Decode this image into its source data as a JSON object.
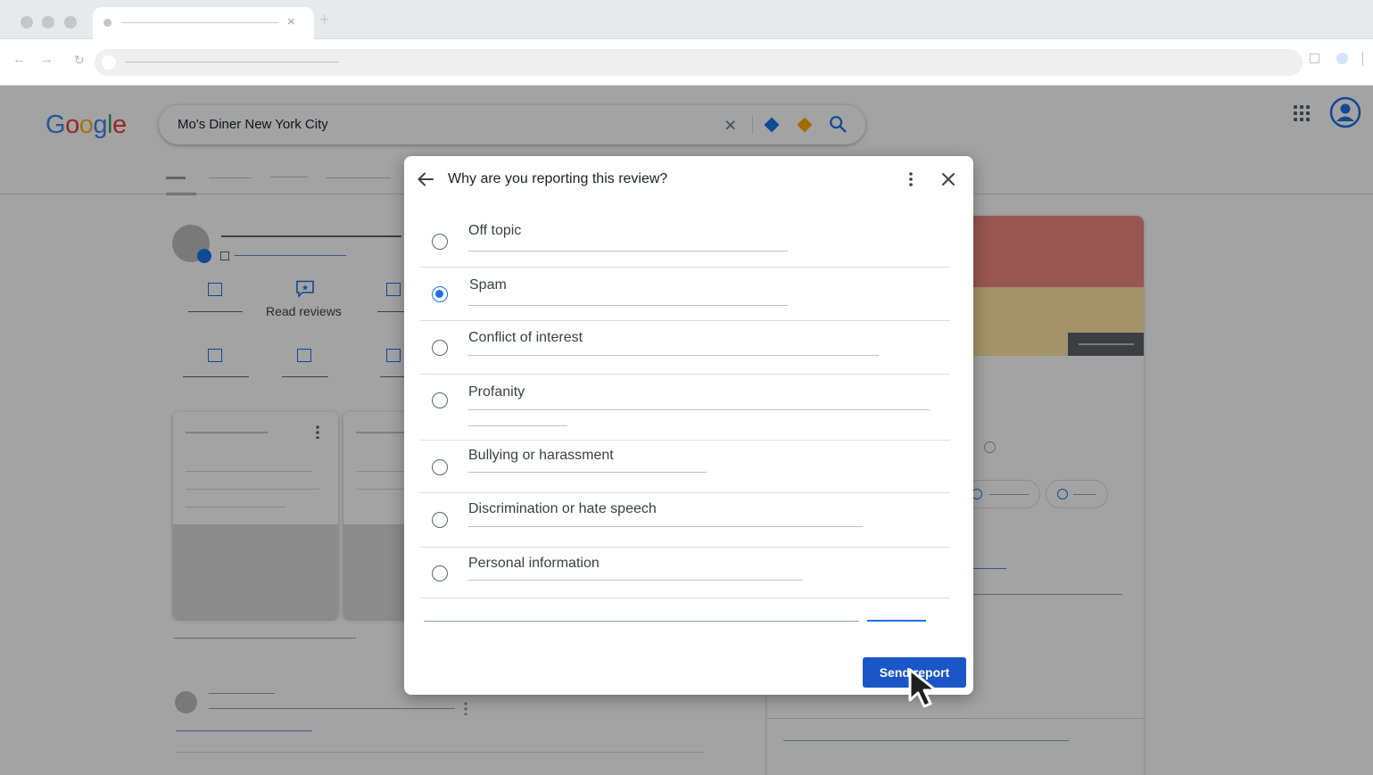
{
  "browser": {
    "tab_close_glyph": "×",
    "new_tab_glyph": "+",
    "back_glyph": "←",
    "forward_glyph": "→",
    "reload_glyph": "↻"
  },
  "search": {
    "logo": [
      "G",
      "o",
      "o",
      "g",
      "l",
      "e"
    ],
    "logo_colors": [
      "#4285f4",
      "#ea4335",
      "#fbbc05",
      "#4285f4",
      "#34a853",
      "#ea4335"
    ],
    "query": "Mo's Diner New York City",
    "clear_glyph": "×"
  },
  "business": {
    "read_reviews_label": "Read reviews"
  },
  "dialog": {
    "title": "Why are you reporting this review?",
    "options": [
      {
        "label": "Off topic",
        "selected": false
      },
      {
        "label": "Spam",
        "selected": true
      },
      {
        "label": "Conflict of interest",
        "selected": false
      },
      {
        "label": "Profanity",
        "selected": false
      },
      {
        "label": "Bullying or harassment",
        "selected": false
      },
      {
        "label": "Discrimination or hate speech",
        "selected": false
      },
      {
        "label": "Personal information",
        "selected": false
      }
    ],
    "send_label": "Send report"
  },
  "colors": {
    "accent": "#1a73e8",
    "button": "#1a56c7",
    "panel_red": "#ee8781",
    "panel_yellow": "#fde7a6"
  },
  "icons": [
    "back-arrow-icon",
    "more-vert-icon",
    "close-icon",
    "search-icon",
    "apps-grid-icon",
    "account-icon",
    "cursor-icon"
  ]
}
